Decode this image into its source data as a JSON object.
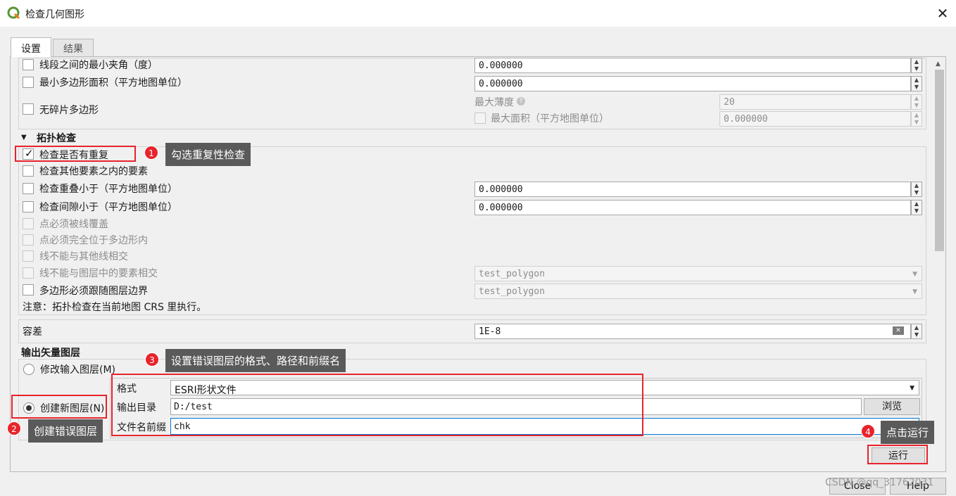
{
  "window": {
    "title": "检查几何图形",
    "close_glyph": "✕"
  },
  "tabs": [
    {
      "label": "设置",
      "active": true
    },
    {
      "label": "结果",
      "active": false
    }
  ],
  "geometry": {
    "min_angle": {
      "label": "线段之间的最小夹角（度）",
      "value": "0.000000"
    },
    "min_area": {
      "label": "最小多边形面积（平方地图单位）",
      "value": "0.000000"
    },
    "no_slivers": {
      "label": "无碎片多边形",
      "max_thinness_label": "最大薄度",
      "max_thinness_value": "20",
      "max_area_label": "最大面积（平方地图单位）",
      "max_area_value": "0.000000"
    }
  },
  "topology": {
    "title": "拓扑检查",
    "items": {
      "duplicates": {
        "label": "检查是否有重复",
        "checked": true
      },
      "within_other": {
        "label": "检查其他要素之内的要素"
      },
      "overlap": {
        "label": "检查重叠小于（平方地图单位）",
        "value": "0.000000"
      },
      "gaps": {
        "label": "检查间隙小于（平方地图单位）",
        "value": "0.000000"
      },
      "point_covered": {
        "label": "点必须被线覆盖"
      },
      "point_in_poly": {
        "label": "点必须完全位于多边形内"
      },
      "line_no_intersect": {
        "label": "线不能与其他线相交"
      },
      "line_no_layer_intersect": {
        "label": "线不能与图层中的要素相交",
        "layer": "test_polygon"
      },
      "poly_follow_boundary": {
        "label": "多边形必须跟随图层边界",
        "layer": "test_polygon"
      }
    },
    "note": "注意：拓扑检查在当前地图 CRS 里执行。"
  },
  "tolerance": {
    "label": "容差",
    "value": "1E-8"
  },
  "output": {
    "title": "输出矢量图层",
    "modify_input": "修改输入图层(M)",
    "create_new": "创建新图层(N)",
    "format_label": "格式",
    "format_value": "ESRI形状文件",
    "dir_label": "输出目录",
    "dir_value": "D:/test",
    "browse": "浏览",
    "prefix_label": "文件名前缀",
    "prefix_value": "chk"
  },
  "buttons": {
    "run": "运行",
    "close": "Close",
    "help": "Help"
  },
  "annotations": [
    {
      "num": "1",
      "text": "勾选重复性检查"
    },
    {
      "num": "2",
      "text": "创建错误图层"
    },
    {
      "num": "3",
      "text": "设置错误图层的格式、路径和前缀名"
    },
    {
      "num": "4",
      "text": "点击运行"
    }
  ],
  "watermark": "CSDN @qq_31762031",
  "colors": {
    "annotation_red": "#e8232b",
    "callout_bg": "#5a5a5a",
    "logo_green": "#589632",
    "focus_blue": "#0078d7"
  }
}
